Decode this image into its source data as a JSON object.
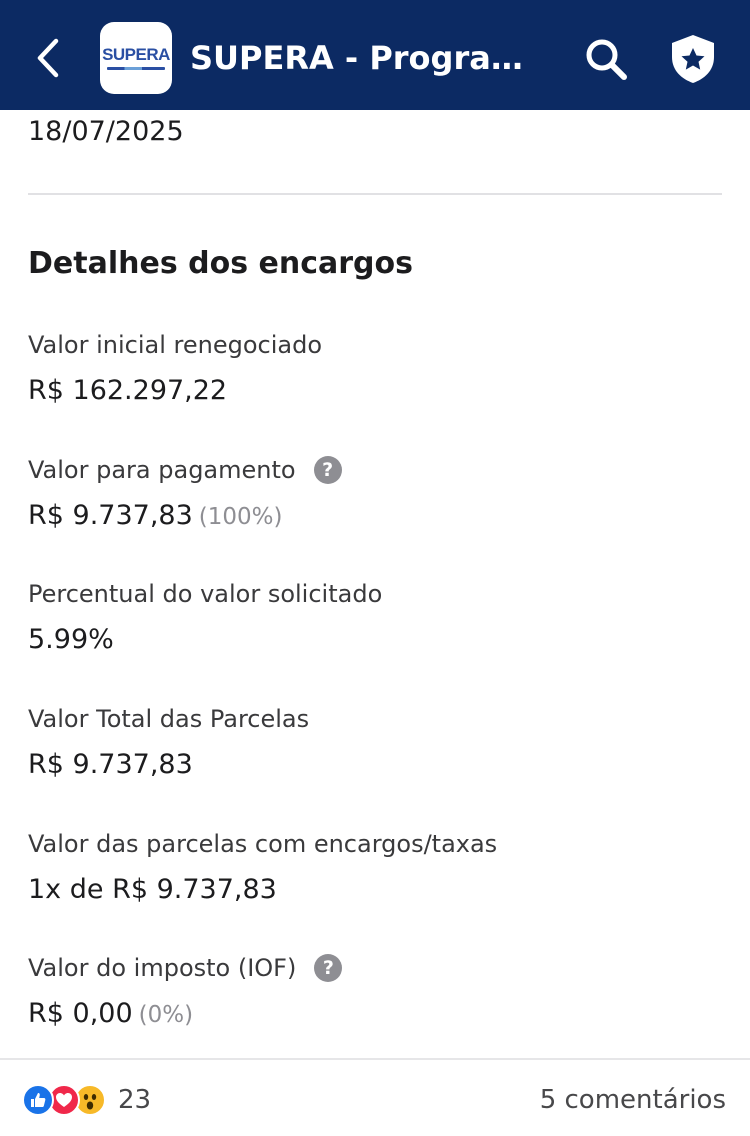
{
  "header": {
    "app_title": "SUPERA - Programa SUPERA",
    "logo_text": "SUPERA",
    "colors": {
      "bar": "#0c2a63",
      "text": "#ffffff"
    },
    "icons": [
      "back-arrow-icon",
      "search-icon",
      "shield-star-icon"
    ]
  },
  "top_date": "18/07/2025",
  "section": {
    "title": "Detalhes dos encargos",
    "fields": [
      {
        "label": "Valor inicial renegociado",
        "value": "R$ 162.297,22"
      },
      {
        "label": "Valor para pagamento",
        "value": "R$ 9.737,83",
        "percent": "(100%)",
        "help": "?"
      },
      {
        "label": "Percentual do valor solicitado",
        "value": "5.99%"
      },
      {
        "label": "Valor Total das Parcelas",
        "value": "R$ 9.737,83"
      },
      {
        "label": "Valor das parcelas com encargos/taxas",
        "value": "1x de R$ 9.737,83"
      },
      {
        "label": "Valor do imposto (IOF)",
        "value": "R$ 0,00",
        "percent": "(0%)",
        "help": "?"
      }
    ]
  },
  "footer": {
    "reactions": [
      "like",
      "love",
      "wow"
    ],
    "reaction_count": "23",
    "comments": "5 comentários"
  }
}
